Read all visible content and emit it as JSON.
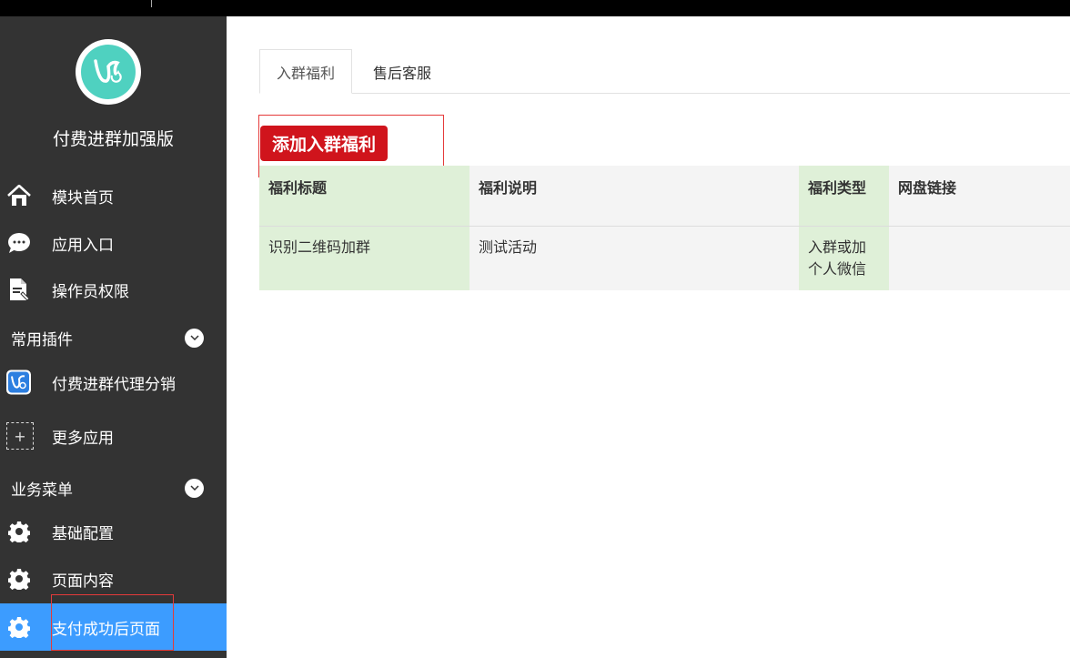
{
  "app": {
    "title": "付费进群加强版"
  },
  "sidebar": {
    "items": [
      {
        "label": "模块首页",
        "icon": "home-icon"
      },
      {
        "label": "应用入口",
        "icon": "chat-icon"
      },
      {
        "label": "操作员权限",
        "icon": "document-icon"
      }
    ],
    "sections": [
      {
        "label": "常用插件",
        "items": [
          {
            "label": "付费进群代理分销",
            "icon": "app-logo-icon"
          },
          {
            "label": "更多应用",
            "icon": "plus-icon"
          }
        ]
      },
      {
        "label": "业务菜单",
        "items": [
          {
            "label": "基础配置",
            "icon": "gear-icon"
          },
          {
            "label": "页面内容",
            "icon": "gear-icon"
          },
          {
            "label": "支付成功后页面",
            "icon": "gear-icon",
            "active": true
          }
        ]
      }
    ]
  },
  "main": {
    "tabs": [
      {
        "label": "入群福利",
        "active": true
      },
      {
        "label": "售后客服",
        "active": false
      }
    ],
    "add_button": "添加入群福利",
    "table": {
      "headers": [
        "福利标题",
        "福利说明",
        "福利类型",
        "网盘链接"
      ],
      "rows": [
        [
          "识别二维码加群",
          "测试活动",
          "入群或加个人微信",
          ""
        ]
      ]
    }
  },
  "colors": {
    "sidebar": "#333333",
    "active": "#3c9cff",
    "button": "#d0141c",
    "highlight": "#dff0d8"
  }
}
